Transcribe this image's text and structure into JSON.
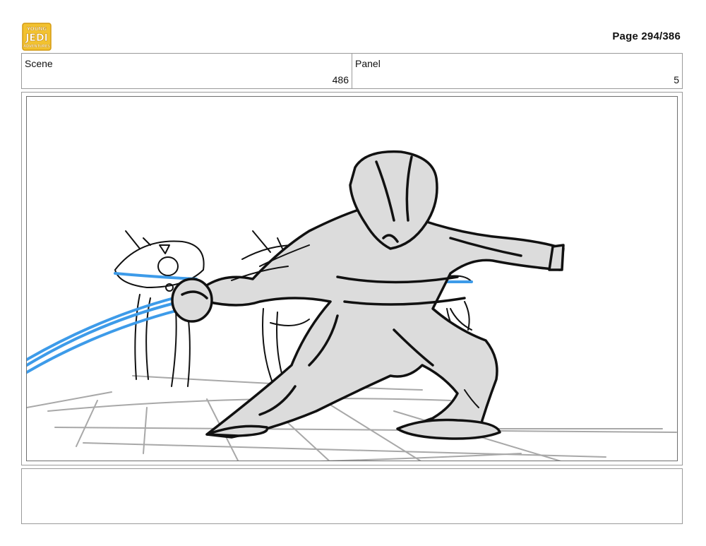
{
  "header": {
    "logo_text": [
      "YOUNG",
      "JEDI",
      "ADVENTURES"
    ],
    "logo_icon": "show-logo",
    "page_label": "Page 294/386"
  },
  "info": {
    "scene_label": "Scene",
    "scene_value": "486",
    "panel_label": "Panel",
    "panel_value": "5"
  },
  "panel": {
    "description_icon": "storyboard-sketch",
    "colors": {
      "ink": "#111111",
      "fill": "#dcdcdc",
      "floor": "#a8a8a8",
      "lightsaber": "#3d9be9"
    }
  },
  "notes": {
    "text": ""
  }
}
